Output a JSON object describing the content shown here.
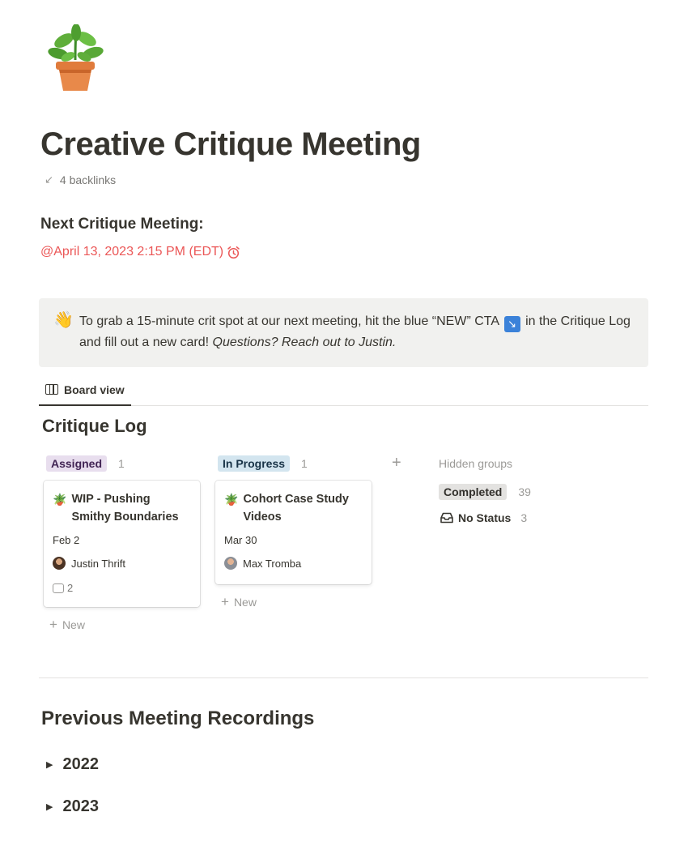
{
  "page": {
    "icon": "potted-plant-icon",
    "title": "Creative Critique Meeting",
    "backlinks": "4 backlinks"
  },
  "next_meeting": {
    "heading": "Next Critique Meeting:",
    "date_mention": "@April 13, 2023 2:15 PM (EDT)",
    "reminder_icon": "alarm-clock-icon",
    "mention_color": "#eb5757"
  },
  "callout": {
    "emoji": "👋",
    "text_before": "To grab a 15-minute crit spot at our next meeting, hit the blue “NEW” CTA",
    "cta_icon_glyph": "↘",
    "text_after": "in the Critique Log and fill out a new card!",
    "text_italic": "Questions? Reach out to Justin."
  },
  "view_tab": {
    "label": "Board view",
    "icon": "board-icon"
  },
  "database": {
    "title": "Critique Log",
    "groups": [
      {
        "label": "Assigned",
        "count": "1",
        "color": "#e8deee",
        "card": {
          "emoji": "🪴",
          "title": "WIP - Pushing Smithy Boundaries",
          "date": "Feb 2",
          "person": "Justin Thrift",
          "comments": "2"
        },
        "new_label": "New"
      },
      {
        "label": "In Progress",
        "count": "1",
        "color": "#d3e5ef",
        "card": {
          "emoji": "🪴",
          "title": "Cohort Case Study Videos",
          "date": "Mar 30",
          "person": "Max Tromba"
        },
        "new_label": "New"
      }
    ],
    "add_group_glyph": "+",
    "hidden_groups": {
      "label": "Hidden groups",
      "items": [
        {
          "label": "Completed",
          "count": "39"
        },
        {
          "label": "No Status",
          "count": "3",
          "icon": "inbox-icon"
        }
      ]
    }
  },
  "recordings": {
    "heading": "Previous Meeting Recordings",
    "toggles": [
      {
        "label": "2022"
      },
      {
        "label": "2023"
      }
    ]
  }
}
